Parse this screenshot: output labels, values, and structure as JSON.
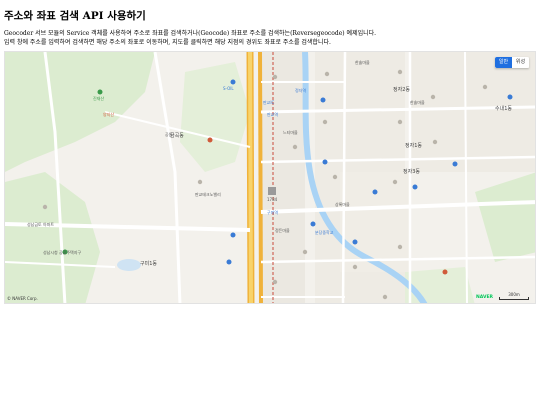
{
  "page": {
    "title": "주소와 좌표 검색 API 사용하기",
    "description_line1": "Geocoder 서브 모듈의 Service 객체를 사용하여 주소로 좌표를 검색하거나(Geocode) 좌표로 주소를 검색하는(Reversegeocode) 예제입니다.",
    "description_line2": "입력 창에 주소를 입력하여 검색하면 해당 주소의 좌표로 이동하며, 지도를 클릭하면 해당 지점의 경위도 좌표로 주소를 검색합니다."
  },
  "map": {
    "type_control": {
      "normal_label": "일반",
      "satellite_label": "위성",
      "selected": "일반"
    },
    "copyright": "© NAVER Corp.",
    "logo_text": "NAVER",
    "scale_label": "300m",
    "colors": {
      "road_major": "#f4c542",
      "road": "#ffffff",
      "water": "#a9d3f5",
      "park": "#d6ecc8",
      "block": "#ece9e2",
      "accent": "#1f6fe0"
    },
    "labels": [
      {
        "text": "진재산",
        "cls": "green"
      },
      {
        "text": "양지산",
        "cls": "red"
      },
      {
        "text": "공원",
        "cls": ""
      },
      {
        "text": "성남금토 아파트",
        "cls": ""
      },
      {
        "text": "성남시청 공공주택지구",
        "cls": ""
      },
      {
        "text": "구미1동",
        "cls": "bold"
      },
      {
        "text": "S-OIL",
        "cls": "blue"
      },
      {
        "text": "판교역",
        "cls": "blue"
      },
      {
        "text": "판교IC",
        "cls": "blue"
      },
      {
        "text": "판교테크노밸리",
        "cls": ""
      },
      {
        "text": "금곡동",
        "cls": "bold"
      },
      {
        "text": "정자2동",
        "cls": "bold"
      },
      {
        "text": "정자3동",
        "cls": "bold"
      },
      {
        "text": "한솔마을",
        "cls": ""
      },
      {
        "text": "수내1동",
        "cls": "bold"
      },
      {
        "text": "한솔마을",
        "cls": ""
      },
      {
        "text": "정자1동",
        "cls": "bold"
      },
      {
        "text": "분당중학교",
        "cls": "blue"
      },
      {
        "text": "정자역",
        "cls": "blue"
      },
      {
        "text": "느티마을",
        "cls": ""
      },
      {
        "text": "상록마을",
        "cls": ""
      },
      {
        "text": "구미역",
        "cls": "blue"
      },
      {
        "text": "정든마을",
        "cls": ""
      },
      {
        "text": "1784",
        "cls": ""
      }
    ]
  }
}
